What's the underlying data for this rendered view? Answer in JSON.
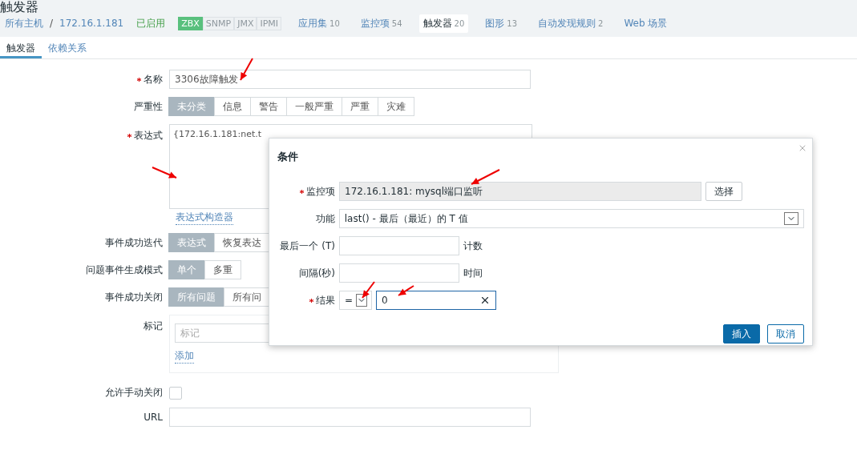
{
  "page_title": "触发器",
  "breadcrumb": [
    {
      "label": "所有主机"
    },
    {
      "label": "172.16.1.181"
    }
  ],
  "breadcrumb_separator": "/",
  "status": "已启用",
  "availability": [
    {
      "label": "ZBX",
      "on": true
    },
    {
      "label": "SNMP",
      "on": false
    },
    {
      "label": "JMX",
      "on": false
    },
    {
      "label": "IPMI",
      "on": false
    }
  ],
  "host_tabs": [
    {
      "label": "应用集",
      "count": "10",
      "selected": false
    },
    {
      "label": "监控项",
      "count": "54",
      "selected": false
    },
    {
      "label": "触发器",
      "count": "20",
      "selected": true
    },
    {
      "label": "图形",
      "count": "13",
      "selected": false
    },
    {
      "label": "自动发现规则",
      "count": "2",
      "selected": false
    },
    {
      "label": "Web 场景",
      "selected": false
    }
  ],
  "tabs": [
    {
      "label": "触发器",
      "selected": true
    },
    {
      "label": "依赖关系",
      "selected": false
    }
  ],
  "form": {
    "name": {
      "label": "名称",
      "required": true,
      "value": "3306故障触发"
    },
    "severity": {
      "label": "严重性",
      "options": [
        {
          "label": "未分类",
          "selected": true
        },
        {
          "label": "信息",
          "selected": false
        },
        {
          "label": "警告",
          "selected": false
        },
        {
          "label": "一般严重",
          "selected": false
        },
        {
          "label": "严重",
          "selected": false
        },
        {
          "label": "灾难",
          "selected": false
        }
      ]
    },
    "expression": {
      "label": "表达式",
      "required": true,
      "value": "{172.16.1.181:net.t"
    },
    "expression_builder": "表达式构造器",
    "ok_event": {
      "label": "事件成功迭代",
      "options": [
        {
          "label": "表达式",
          "selected": true
        },
        {
          "label": "恢复表达",
          "selected": false
        }
      ]
    },
    "problem_mode": {
      "label": "问题事件生成模式",
      "options": [
        {
          "label": "单个",
          "selected": true
        },
        {
          "label": "多重",
          "selected": false
        }
      ]
    },
    "ok_close": {
      "label": "事件成功关闭",
      "options": [
        {
          "label": "所有问题",
          "selected": true
        },
        {
          "label": "所有问",
          "selected": false
        }
      ]
    },
    "tags": {
      "label": "标记",
      "placeholder": "标记",
      "add": "添加"
    },
    "manual_close": {
      "label": "允许手动关闭",
      "checked": false
    },
    "url": {
      "label": "URL"
    }
  },
  "dialog": {
    "title": "条件",
    "item": {
      "label": "监控项",
      "required": true,
      "value": "172.16.1.181: mysql端口监听",
      "button": "选择"
    },
    "function": {
      "label": "功能",
      "value": "last() - 最后（最近）的 T 值"
    },
    "last": {
      "label": "最后一个 (T)",
      "unit": "计数"
    },
    "interval": {
      "label": "间隔(秒)",
      "unit": "时间"
    },
    "result": {
      "label": "结果",
      "required": true,
      "operator": "=",
      "value": "0"
    },
    "buttons": [
      {
        "label": "插入",
        "kind": "primary"
      },
      {
        "label": "取消",
        "kind": "secondary"
      }
    ]
  }
}
